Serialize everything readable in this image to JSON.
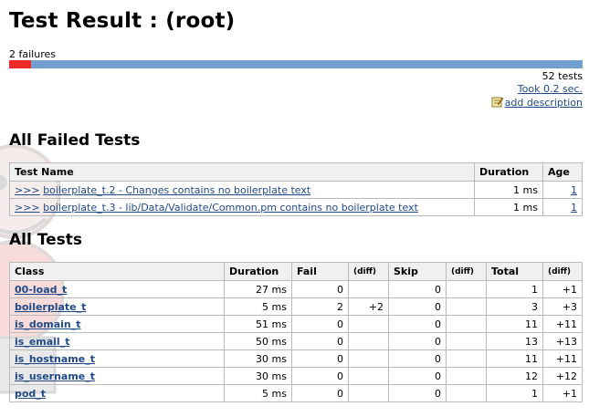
{
  "header": {
    "title": "Test Result : (root)"
  },
  "status": {
    "failure_label": "2 failures",
    "total_tests": "52 tests",
    "took": "Took 0.2 sec.",
    "add_description": "add description",
    "fail_fraction": 0.0385
  },
  "colors": {
    "fail": "#ef2929",
    "pass": "#729fcf",
    "link": "#204a87"
  },
  "failed_section": {
    "heading": "All Failed Tests",
    "columns": {
      "name": "Test Name",
      "duration": "Duration",
      "age": "Age"
    },
    "rows": [
      {
        "prefix": ">>>",
        "name": "boilerplate_t.2 - Changes contains no boilerplate text",
        "duration": "1 ms",
        "age": "1"
      },
      {
        "prefix": ">>>",
        "name": "boilerplate_t.3 - lib/Data/Validate/Common.pm contains no boilerplate text",
        "duration": "1 ms",
        "age": "1"
      }
    ]
  },
  "all_section": {
    "heading": "All Tests",
    "columns": {
      "class": "Class",
      "duration": "Duration",
      "fail": "Fail",
      "fail_diff": "(diff)",
      "skip": "Skip",
      "skip_diff": "(diff)",
      "total": "Total",
      "total_diff": "(diff)"
    },
    "rows": [
      {
        "class": "00-load_t",
        "duration": "27 ms",
        "fail": "0",
        "fail_diff": "",
        "skip": "0",
        "skip_diff": "",
        "total": "1",
        "total_diff": "+1"
      },
      {
        "class": "boilerplate_t",
        "duration": "5 ms",
        "fail": "2",
        "fail_diff": "+2",
        "skip": "0",
        "skip_diff": "",
        "total": "3",
        "total_diff": "+3"
      },
      {
        "class": "is_domain_t",
        "duration": "51 ms",
        "fail": "0",
        "fail_diff": "",
        "skip": "0",
        "skip_diff": "",
        "total": "11",
        "total_diff": "+11"
      },
      {
        "class": "is_email_t",
        "duration": "50 ms",
        "fail": "0",
        "fail_diff": "",
        "skip": "0",
        "skip_diff": "",
        "total": "13",
        "total_diff": "+13"
      },
      {
        "class": "is_hostname_t",
        "duration": "30 ms",
        "fail": "0",
        "fail_diff": "",
        "skip": "0",
        "skip_diff": "",
        "total": "11",
        "total_diff": "+11"
      },
      {
        "class": "is_username_t",
        "duration": "30 ms",
        "fail": "0",
        "fail_diff": "",
        "skip": "0",
        "skip_diff": "",
        "total": "12",
        "total_diff": "+12"
      },
      {
        "class": "pod_t",
        "duration": "5 ms",
        "fail": "0",
        "fail_diff": "",
        "skip": "0",
        "skip_diff": "",
        "total": "1",
        "total_diff": "+1"
      }
    ]
  }
}
